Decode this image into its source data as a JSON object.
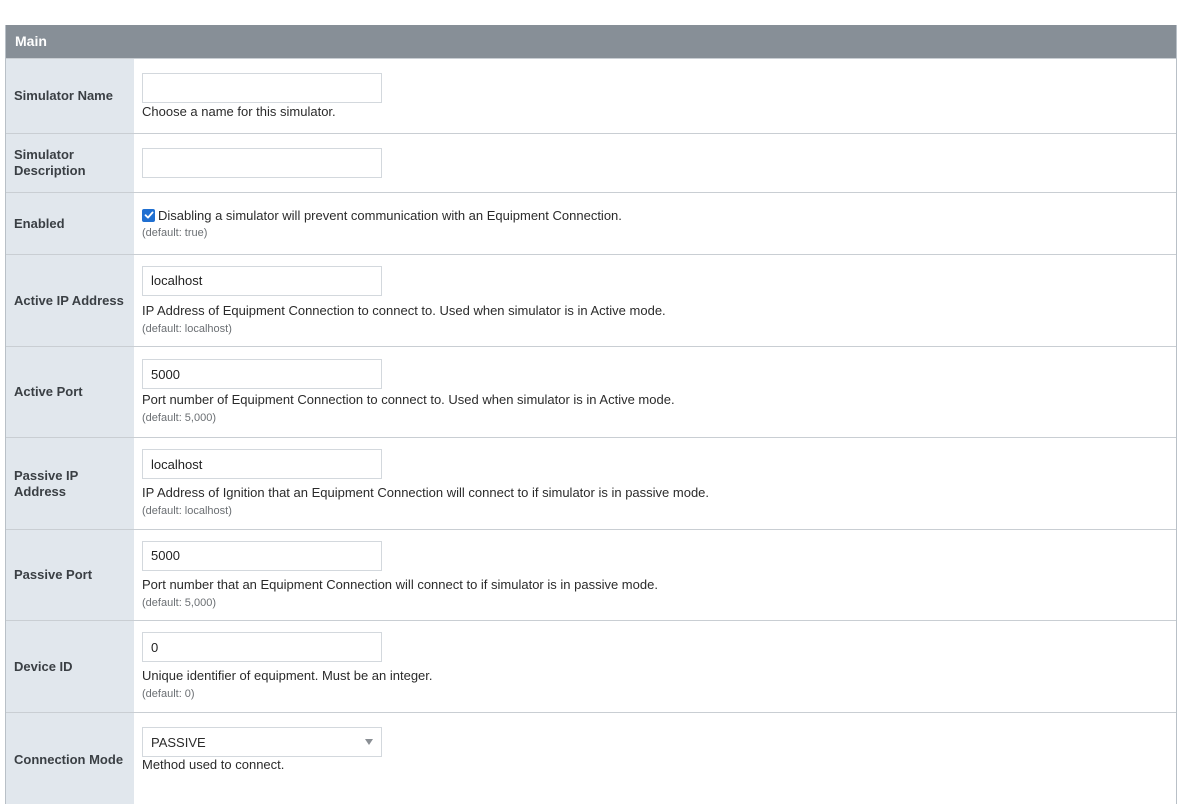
{
  "section": {
    "title": "Main"
  },
  "fields": {
    "simulator_name": {
      "label": "Simulator Name",
      "value": "",
      "help": "Choose a name for this simulator."
    },
    "simulator_description": {
      "label": "Simulator Description",
      "value": ""
    },
    "enabled": {
      "label": "Enabled",
      "checked": true,
      "help": "Disabling a simulator will prevent communication with an Equipment Connection.",
      "default": "(default: true)"
    },
    "active_ip": {
      "label": "Active IP Address",
      "value": "localhost",
      "help": "IP Address of Equipment Connection to connect to. Used when simulator is in Active mode.",
      "default": "(default: localhost)"
    },
    "active_port": {
      "label": "Active Port",
      "value": "5000",
      "help": "Port number of Equipment Connection to connect to. Used when simulator is in Active mode.",
      "default": "(default: 5,000)"
    },
    "passive_ip": {
      "label": "Passive IP Address",
      "value": "localhost",
      "help": "IP Address of Ignition that an Equipment Connection will connect to if simulator is in passive mode.",
      "default": "(default: localhost)"
    },
    "passive_port": {
      "label": "Passive Port",
      "value": "5000",
      "help": "Port number that an Equipment Connection will connect to if simulator is in passive mode.",
      "default": "(default: 5,000)"
    },
    "device_id": {
      "label": "Device ID",
      "value": "0",
      "help": "Unique identifier of equipment. Must be an integer.",
      "default": "(default: 0)"
    },
    "connection_mode": {
      "label": "Connection Mode",
      "selected": "PASSIVE",
      "help": "Method used to connect."
    }
  },
  "colors": {
    "header_bg": "#878f97",
    "label_bg": "#e1e7ed",
    "checkbox": "#1f6fd1"
  }
}
